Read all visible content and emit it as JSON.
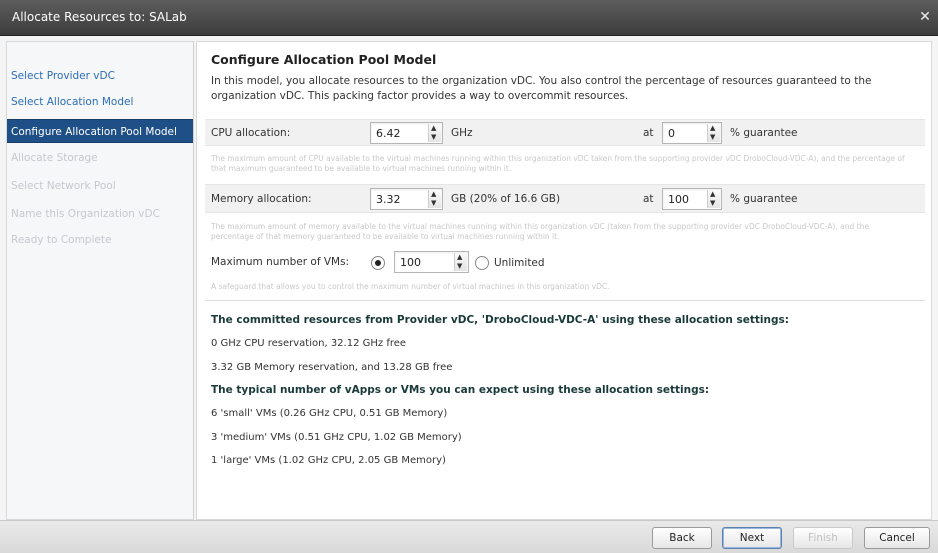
{
  "window": {
    "title": "Allocate Resources to: SALab",
    "close_glyph": "✕"
  },
  "sidebar": {
    "items": [
      {
        "label": "Select Provider vDC",
        "state": "done"
      },
      {
        "label": "Select Allocation Model",
        "state": "done"
      },
      {
        "label": "Configure Allocation Pool Model",
        "state": "active"
      },
      {
        "label": "Allocate Storage",
        "state": "disabled"
      },
      {
        "label": "Select Network Pool",
        "state": "disabled"
      },
      {
        "label": "Name this Organization vDC",
        "state": "disabled"
      },
      {
        "label": "Ready to Complete",
        "state": "disabled"
      }
    ]
  },
  "main": {
    "heading": "Configure Allocation Pool Model",
    "intro": "In this model, you allocate resources to the organization vDC. You also control the percentage of resources guaranteed to the organization vDC. This packing factor provides a way to overcommit resources.",
    "cpu": {
      "label": "CPU allocation:",
      "value": "6.42",
      "unit": "GHz",
      "at_label": "at",
      "guarantee_value": "0",
      "guarantee_label": "% guarantee",
      "hint": "The maximum amount of CPU available to the virtual machines running within this organization vDC taken from the supporting provider vDC DroboCloud-VDC-A), and the percentage of that maximum guaranteed to be available to virtual machines running within it."
    },
    "memory": {
      "label": "Memory allocation:",
      "value": "3.32",
      "unit": "GB (20% of 16.6 GB)",
      "at_label": "at",
      "guarantee_value": "100",
      "guarantee_label": "% guarantee",
      "hint": "The maximum amount of memory available to the virtual machines running within this organization vDC (taken from the supporting provider vDC DroboCloud-VDC-A), and the percentage of that memory guaranteed to be available to virtual machines running within it."
    },
    "vms": {
      "label": "Maximum number of VMs:",
      "value": "100",
      "unlimited_label": "Unlimited",
      "selected": "value",
      "hint": "A safeguard that allows you to control the maximum number of virtual machines in this organization vDC."
    },
    "committed": {
      "heading": "The committed resources from Provider vDC, 'DroboCloud-VDC-A' using these allocation settings:",
      "cpu_line": "0 GHz CPU reservation, 32.12 GHz free",
      "mem_line": "3.32 GB Memory reservation, and 13.28 GB free"
    },
    "typical": {
      "heading": "The typical number of vApps or VMs you can expect using these allocation settings:",
      "lines": [
        "6 'small' VMs (0.26 GHz CPU, 0.51 GB Memory)",
        "3 'medium' VMs (0.51 GHz CPU, 1.02 GB Memory)",
        "1 'large' VMs (1.02 GHz CPU, 2.05 GB Memory)"
      ]
    }
  },
  "footer": {
    "back_label": "Back",
    "next_label": "Next",
    "finish_label": "Finish",
    "cancel_label": "Cancel"
  }
}
